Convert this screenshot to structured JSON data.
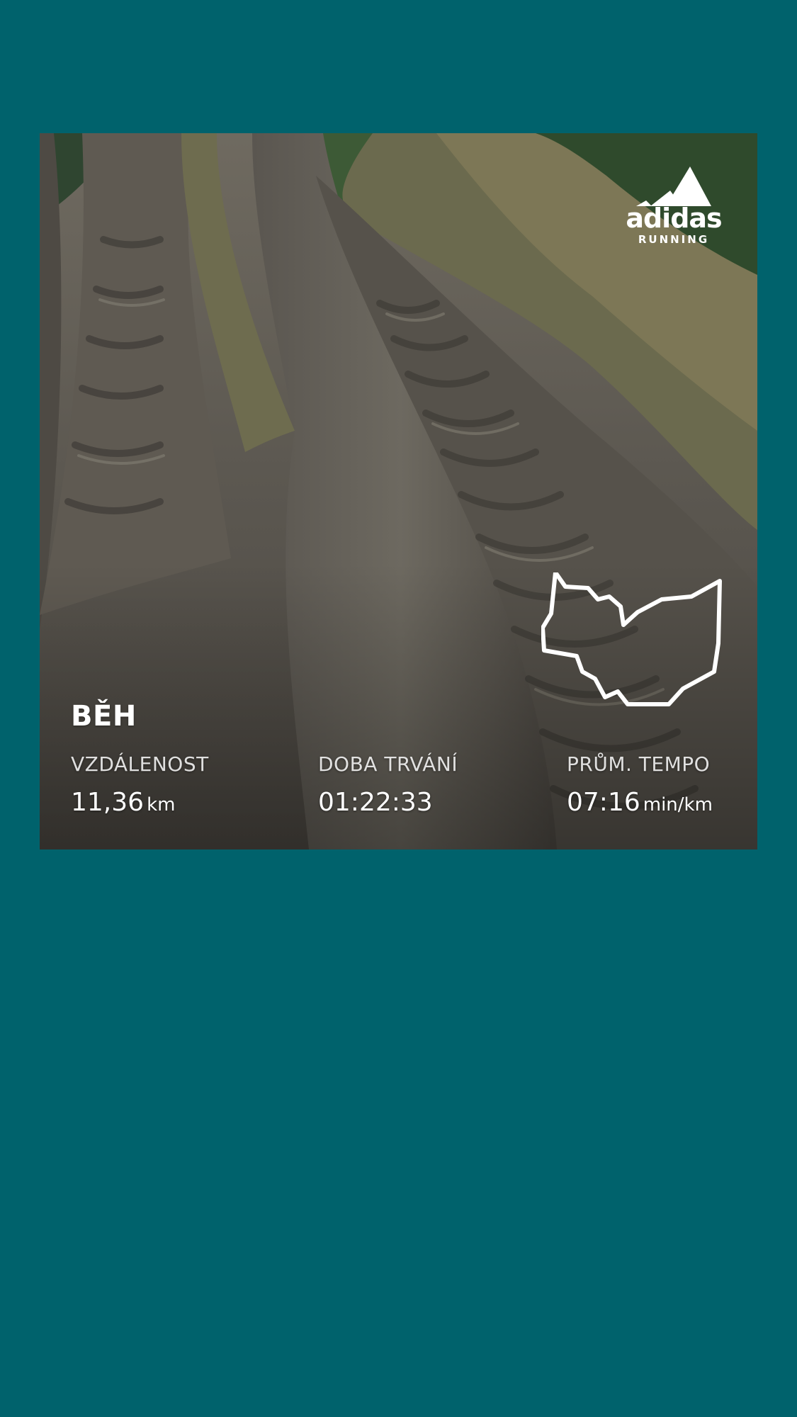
{
  "colors": {
    "background": "#00626c",
    "text": "#ffffff"
  },
  "logo": {
    "brand": "adidas",
    "subtitle": "RUNNING",
    "icon": "adidas-stripes-icon"
  },
  "route_icon": "route-map-icon",
  "activity": {
    "title": "BĚH"
  },
  "stats": {
    "distance": {
      "label": "VZDÁLENOST",
      "value": "11,36",
      "unit": "km"
    },
    "duration": {
      "label": "DOBA TRVÁNÍ",
      "value": "01:22:33",
      "unit": ""
    },
    "pace": {
      "label": "PRŮM. TEMPO",
      "value": "07:16",
      "unit": "min/km"
    }
  }
}
